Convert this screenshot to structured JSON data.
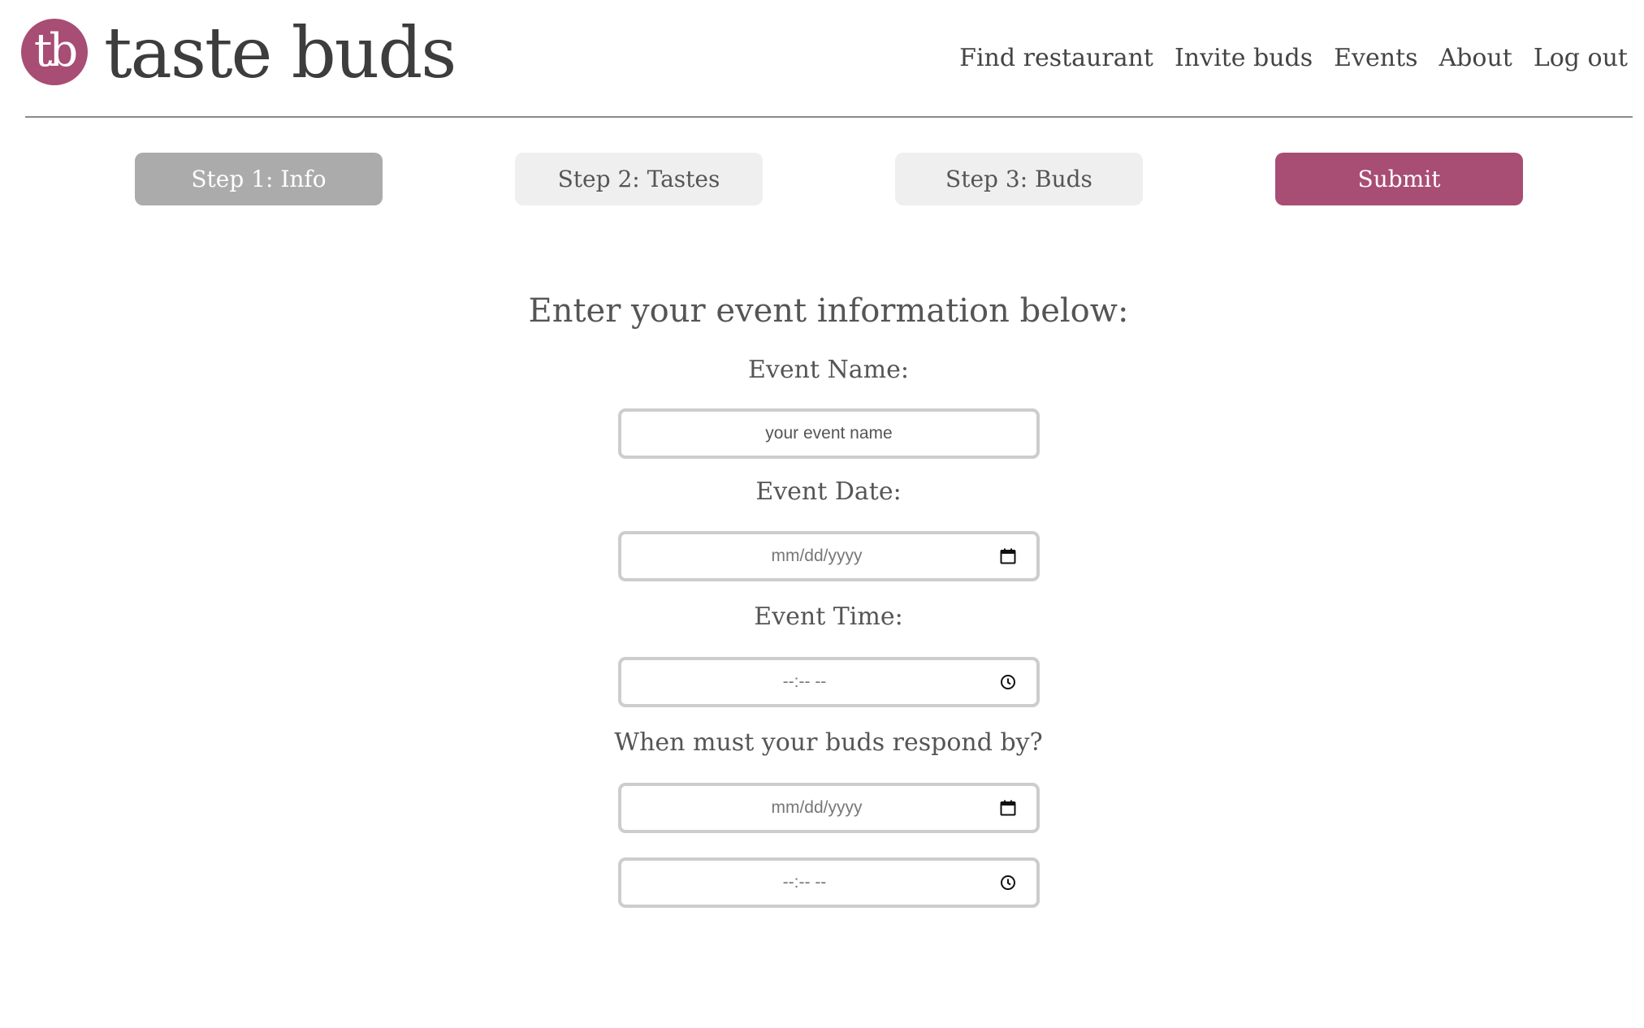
{
  "brand": {
    "logo_text": "tb",
    "name": "taste buds",
    "accent_color": "#a84d74"
  },
  "nav": {
    "items": [
      {
        "label": "Find restaurant"
      },
      {
        "label": "Invite buds"
      },
      {
        "label": "Events"
      },
      {
        "label": "About"
      },
      {
        "label": "Log out"
      }
    ]
  },
  "steps": [
    {
      "label": "Step 1: Info",
      "state": "active"
    },
    {
      "label": "Step 2: Tastes",
      "state": "inactive"
    },
    {
      "label": "Step 3: Buds",
      "state": "inactive"
    },
    {
      "label": "Submit",
      "state": "primary"
    }
  ],
  "form": {
    "title": "Enter your event information below:",
    "event_name": {
      "label": "Event Name:",
      "placeholder": "your event name"
    },
    "event_date": {
      "label": "Event Date:",
      "placeholder": "mm/dd/yyyy",
      "icon": "calendar-icon"
    },
    "event_time": {
      "label": "Event Time:",
      "placeholder": "--:-- --",
      "icon": "clock-icon"
    },
    "respond_by": {
      "label": "When must your buds respond by?",
      "date_placeholder": "mm/dd/yyyy",
      "time_placeholder": "--:-- --"
    }
  }
}
